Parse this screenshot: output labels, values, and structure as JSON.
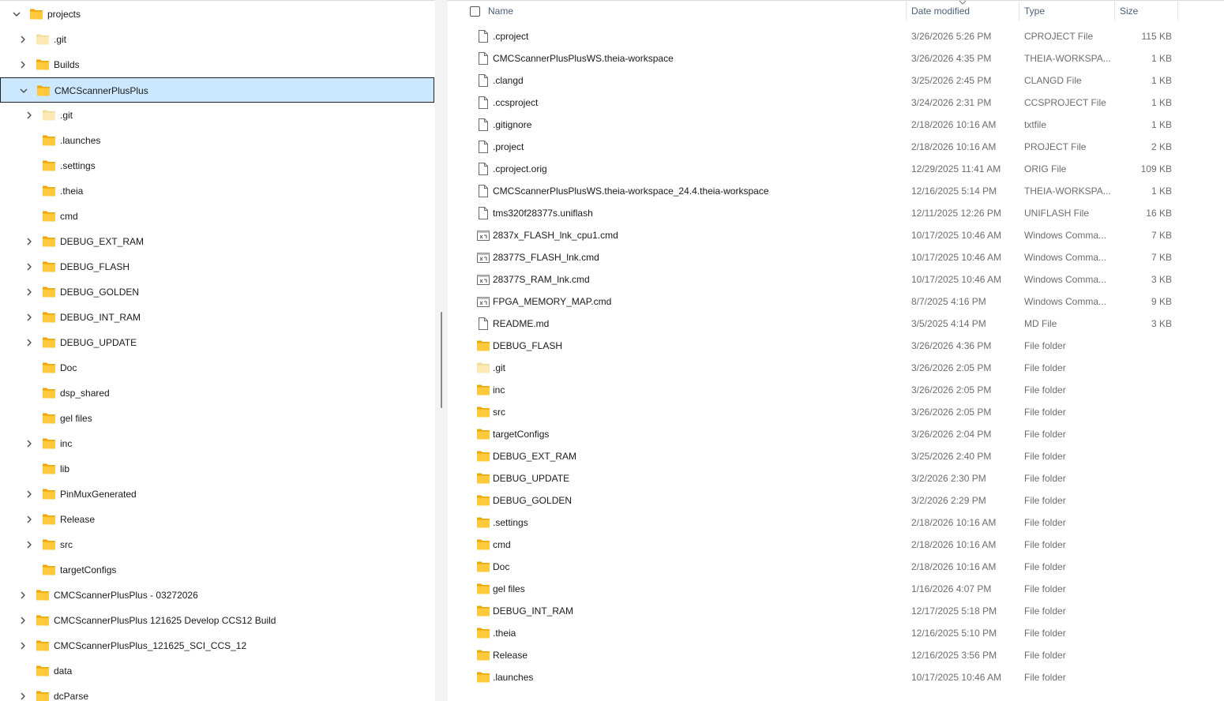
{
  "nav_tree": [
    {
      "label": "projects",
      "level": 0,
      "chevron": "down",
      "icon": "folder-icon",
      "selected": false
    },
    {
      "label": ".git",
      "level": 1,
      "chevron": "right",
      "icon": "hidden-folder-icon",
      "selected": false
    },
    {
      "label": "Builds",
      "level": 1,
      "chevron": "right",
      "icon": "folder-icon",
      "selected": false
    },
    {
      "label": "CMCScannerPlusPlus",
      "level": 1,
      "chevron": "down",
      "icon": "folder-icon",
      "selected": true
    },
    {
      "label": ".git",
      "level": 2,
      "chevron": "right",
      "icon": "hidden-folder-icon",
      "selected": false
    },
    {
      "label": ".launches",
      "level": 2,
      "chevron": "none",
      "icon": "folder-icon",
      "selected": false
    },
    {
      "label": ".settings",
      "level": 2,
      "chevron": "none",
      "icon": "folder-icon",
      "selected": false
    },
    {
      "label": ".theia",
      "level": 2,
      "chevron": "none",
      "icon": "folder-icon",
      "selected": false
    },
    {
      "label": "cmd",
      "level": 2,
      "chevron": "none",
      "icon": "folder-icon",
      "selected": false
    },
    {
      "label": "DEBUG_EXT_RAM",
      "level": 2,
      "chevron": "right",
      "icon": "folder-icon",
      "selected": false
    },
    {
      "label": "DEBUG_FLASH",
      "level": 2,
      "chevron": "right",
      "icon": "folder-icon",
      "selected": false
    },
    {
      "label": "DEBUG_GOLDEN",
      "level": 2,
      "chevron": "right",
      "icon": "folder-icon",
      "selected": false
    },
    {
      "label": "DEBUG_INT_RAM",
      "level": 2,
      "chevron": "right",
      "icon": "folder-icon",
      "selected": false
    },
    {
      "label": "DEBUG_UPDATE",
      "level": 2,
      "chevron": "right",
      "icon": "folder-icon",
      "selected": false
    },
    {
      "label": "Doc",
      "level": 2,
      "chevron": "none",
      "icon": "folder-icon",
      "selected": false
    },
    {
      "label": "dsp_shared",
      "level": 2,
      "chevron": "none",
      "icon": "folder-icon",
      "selected": false
    },
    {
      "label": "gel files",
      "level": 2,
      "chevron": "none",
      "icon": "folder-icon",
      "selected": false
    },
    {
      "label": "inc",
      "level": 2,
      "chevron": "right",
      "icon": "folder-icon",
      "selected": false
    },
    {
      "label": "lib",
      "level": 2,
      "chevron": "none",
      "icon": "folder-icon",
      "selected": false
    },
    {
      "label": "PinMuxGenerated",
      "level": 2,
      "chevron": "right",
      "icon": "folder-icon",
      "selected": false
    },
    {
      "label": "Release",
      "level": 2,
      "chevron": "right",
      "icon": "folder-icon",
      "selected": false
    },
    {
      "label": "src",
      "level": 2,
      "chevron": "right",
      "icon": "folder-icon",
      "selected": false
    },
    {
      "label": "targetConfigs",
      "level": 2,
      "chevron": "none",
      "icon": "folder-icon",
      "selected": false
    },
    {
      "label": "CMCScannerPlusPlus - 03272026",
      "level": 1,
      "chevron": "right",
      "icon": "folder-icon",
      "selected": false
    },
    {
      "label": "CMCScannerPlusPlus 121625 Develop CCS12 Build",
      "level": 1,
      "chevron": "right",
      "icon": "folder-icon",
      "selected": false
    },
    {
      "label": "CMCScannerPlusPlus_121625_SCI_CCS_12",
      "level": 1,
      "chevron": "right",
      "icon": "folder-icon",
      "selected": false
    },
    {
      "label": "data",
      "level": 1,
      "chevron": "none",
      "icon": "folder-icon",
      "selected": false
    },
    {
      "label": "dcParse",
      "level": 1,
      "chevron": "right",
      "icon": "folder-icon",
      "selected": false
    }
  ],
  "columns": {
    "name": "Name",
    "date": "Date modified",
    "type": "Type",
    "size": "Size"
  },
  "files": [
    {
      "name": ".cproject",
      "date": "3/26/2026 5:26 PM",
      "type": "CPROJECT File",
      "size": "115 KB",
      "icon": "file-icon"
    },
    {
      "name": "CMCScannerPlusPlusWS.theia-workspace",
      "date": "3/26/2026 4:35 PM",
      "type": "THEIA-WORKSPA...",
      "size": "1 KB",
      "icon": "file-icon"
    },
    {
      "name": ".clangd",
      "date": "3/25/2026 2:45 PM",
      "type": "CLANGD File",
      "size": "1 KB",
      "icon": "file-icon"
    },
    {
      "name": ".ccsproject",
      "date": "3/24/2026 2:31 PM",
      "type": "CCSPROJECT File",
      "size": "1 KB",
      "icon": "file-icon"
    },
    {
      "name": ".gitignore",
      "date": "2/18/2026 10:16 AM",
      "type": "txtfile",
      "size": "1 KB",
      "icon": "file-icon"
    },
    {
      "name": ".project",
      "date": "2/18/2026 10:16 AM",
      "type": "PROJECT File",
      "size": "2 KB",
      "icon": "file-icon"
    },
    {
      "name": ".cproject.orig",
      "date": "12/29/2025 11:41 AM",
      "type": "ORIG File",
      "size": "109 KB",
      "icon": "file-icon"
    },
    {
      "name": "CMCScannerPlusPlusWS.theia-workspace_24.4.theia-workspace",
      "date": "12/16/2025 5:14 PM",
      "type": "THEIA-WORKSPA...",
      "size": "1 KB",
      "icon": "file-icon"
    },
    {
      "name": "tms320f28377s.uniflash",
      "date": "12/11/2025 12:26 PM",
      "type": "UNIFLASH File",
      "size": "16 KB",
      "icon": "file-icon"
    },
    {
      "name": "2837x_FLASH_lnk_cpu1.cmd",
      "date": "10/17/2025 10:46 AM",
      "type": "Windows Comma...",
      "size": "7 KB",
      "icon": "cmd-file-icon"
    },
    {
      "name": "28377S_FLASH_lnk.cmd",
      "date": "10/17/2025 10:46 AM",
      "type": "Windows Comma...",
      "size": "7 KB",
      "icon": "cmd-file-icon"
    },
    {
      "name": "28377S_RAM_lnk.cmd",
      "date": "10/17/2025 10:46 AM",
      "type": "Windows Comma...",
      "size": "3 KB",
      "icon": "cmd-file-icon"
    },
    {
      "name": "FPGA_MEMORY_MAP.cmd",
      "date": "8/7/2025 4:16 PM",
      "type": "Windows Comma...",
      "size": "9 KB",
      "icon": "cmd-file-icon"
    },
    {
      "name": "README.md",
      "date": "3/5/2025 4:14 PM",
      "type": "MD File",
      "size": "3 KB",
      "icon": "file-icon"
    },
    {
      "name": "DEBUG_FLASH",
      "date": "3/26/2026 4:36 PM",
      "type": "File folder",
      "size": "",
      "icon": "folder-icon"
    },
    {
      "name": ".git",
      "date": "3/26/2026 2:05 PM",
      "type": "File folder",
      "size": "",
      "icon": "hidden-folder-icon"
    },
    {
      "name": "inc",
      "date": "3/26/2026 2:05 PM",
      "type": "File folder",
      "size": "",
      "icon": "folder-icon"
    },
    {
      "name": "src",
      "date": "3/26/2026 2:05 PM",
      "type": "File folder",
      "size": "",
      "icon": "folder-icon"
    },
    {
      "name": "targetConfigs",
      "date": "3/26/2026 2:04 PM",
      "type": "File folder",
      "size": "",
      "icon": "folder-icon"
    },
    {
      "name": "DEBUG_EXT_RAM",
      "date": "3/25/2026 2:40 PM",
      "type": "File folder",
      "size": "",
      "icon": "folder-icon"
    },
    {
      "name": "DEBUG_UPDATE",
      "date": "3/2/2026 2:30 PM",
      "type": "File folder",
      "size": "",
      "icon": "folder-icon"
    },
    {
      "name": "DEBUG_GOLDEN",
      "date": "3/2/2026 2:29 PM",
      "type": "File folder",
      "size": "",
      "icon": "folder-icon"
    },
    {
      "name": ".settings",
      "date": "2/18/2026 10:16 AM",
      "type": "File folder",
      "size": "",
      "icon": "folder-icon"
    },
    {
      "name": "cmd",
      "date": "2/18/2026 10:16 AM",
      "type": "File folder",
      "size": "",
      "icon": "folder-icon"
    },
    {
      "name": "Doc",
      "date": "2/18/2026 10:16 AM",
      "type": "File folder",
      "size": "",
      "icon": "folder-icon"
    },
    {
      "name": "gel files",
      "date": "1/16/2026 4:07 PM",
      "type": "File folder",
      "size": "",
      "icon": "folder-icon"
    },
    {
      "name": "DEBUG_INT_RAM",
      "date": "12/17/2025 5:18 PM",
      "type": "File folder",
      "size": "",
      "icon": "folder-icon"
    },
    {
      "name": ".theia",
      "date": "12/16/2025 5:10 PM",
      "type": "File folder",
      "size": "",
      "icon": "folder-icon"
    },
    {
      "name": "Release",
      "date": "12/16/2025 3:56 PM",
      "type": "File folder",
      "size": "",
      "icon": "folder-icon"
    },
    {
      "name": ".launches",
      "date": "10/17/2025 10:46 AM",
      "type": "File folder",
      "size": "",
      "icon": "folder-icon"
    }
  ],
  "colors": {
    "selection": "#cce8ff",
    "folder": "#ffc83d",
    "folder_dark": "#e8a800",
    "header_text": "#4c607a",
    "secondary_text": "#6d6d6d"
  }
}
